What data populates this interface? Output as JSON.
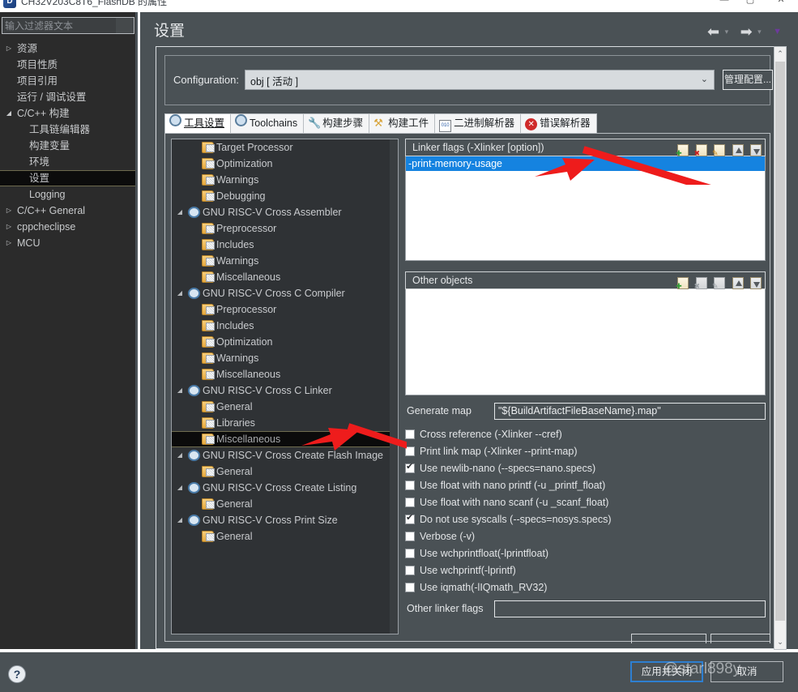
{
  "window": {
    "title": "CH32V203C8T6_FlashDB 的属性",
    "icon": "app-icon",
    "minimize": "—",
    "maximize": "▢",
    "close": "✕"
  },
  "sidebar": {
    "filter_placeholder": "输入过滤器文本",
    "filter_value": "",
    "items": [
      {
        "label": "资源",
        "level": 0,
        "arrow": "▷",
        "selected": false
      },
      {
        "label": "项目性质",
        "level": 0,
        "arrow": "",
        "selected": false
      },
      {
        "label": "项目引用",
        "level": 0,
        "arrow": "",
        "selected": false
      },
      {
        "label": "运行 / 调试设置",
        "level": 0,
        "arrow": "",
        "selected": false
      },
      {
        "label": "C/C++ 构建",
        "level": 0,
        "arrow": "◢",
        "selected": false
      },
      {
        "label": "工具链编辑器",
        "level": 1,
        "arrow": "",
        "selected": false
      },
      {
        "label": "构建变量",
        "level": 1,
        "arrow": "",
        "selected": false
      },
      {
        "label": "环境",
        "level": 1,
        "arrow": "",
        "selected": false
      },
      {
        "label": "设置",
        "level": 1,
        "arrow": "",
        "selected": true
      },
      {
        "label": "Logging",
        "level": 1,
        "arrow": "",
        "selected": false
      },
      {
        "label": "C/C++ General",
        "level": 0,
        "arrow": "▷",
        "selected": false
      },
      {
        "label": "cppcheclipse",
        "level": 0,
        "arrow": "▷",
        "selected": false
      },
      {
        "label": "MCU",
        "level": 0,
        "arrow": "▷",
        "selected": false
      }
    ]
  },
  "page": {
    "title": "设置",
    "nav_back": "⬅",
    "nav_back_chevron": "▾",
    "nav_forward": "➡",
    "nav_forward_chevron": "▾",
    "nav_menu_chevron": "▼"
  },
  "configuration": {
    "label": "Configuration:",
    "value": "obj  [ 活动 ]",
    "chevron": "⌄",
    "manage_button": "管理配置..."
  },
  "tabs": [
    {
      "label": "工具设置",
      "icon": "gear-icon",
      "active": true
    },
    {
      "label": "Toolchains",
      "icon": "gear-icon",
      "active": false
    },
    {
      "label": "构建步骤",
      "icon": "wrench-icon",
      "active": false
    },
    {
      "label": "构建工件",
      "icon": "hammer-icon",
      "active": false
    },
    {
      "label": "二进制解析器",
      "icon": "binary-icon",
      "active": false
    },
    {
      "label": "错误解析器",
      "icon": "error-icon",
      "active": false
    }
  ],
  "tool_tree": [
    {
      "label": "Target Processor",
      "depth": 2,
      "icon": "folder-icon",
      "arrow": "",
      "selected": false
    },
    {
      "label": "Optimization",
      "depth": 2,
      "icon": "folder-icon",
      "arrow": "",
      "selected": false
    },
    {
      "label": "Warnings",
      "depth": 2,
      "icon": "folder-icon",
      "arrow": "",
      "selected": false
    },
    {
      "label": "Debugging",
      "depth": 2,
      "icon": "folder-icon",
      "arrow": "",
      "selected": false
    },
    {
      "label": "GNU RISC-V Cross Assembler",
      "depth": 1,
      "icon": "tool-icon",
      "arrow": "◢",
      "selected": false
    },
    {
      "label": "Preprocessor",
      "depth": 2,
      "icon": "folder-icon",
      "arrow": "",
      "selected": false
    },
    {
      "label": "Includes",
      "depth": 2,
      "icon": "folder-icon",
      "arrow": "",
      "selected": false
    },
    {
      "label": "Warnings",
      "depth": 2,
      "icon": "folder-icon",
      "arrow": "",
      "selected": false
    },
    {
      "label": "Miscellaneous",
      "depth": 2,
      "icon": "folder-icon",
      "arrow": "",
      "selected": false
    },
    {
      "label": "GNU RISC-V Cross C Compiler",
      "depth": 1,
      "icon": "tool-icon",
      "arrow": "◢",
      "selected": false
    },
    {
      "label": "Preprocessor",
      "depth": 2,
      "icon": "folder-icon",
      "arrow": "",
      "selected": false
    },
    {
      "label": "Includes",
      "depth": 2,
      "icon": "folder-icon",
      "arrow": "",
      "selected": false
    },
    {
      "label": "Optimization",
      "depth": 2,
      "icon": "folder-icon",
      "arrow": "",
      "selected": false
    },
    {
      "label": "Warnings",
      "depth": 2,
      "icon": "folder-icon",
      "arrow": "",
      "selected": false
    },
    {
      "label": "Miscellaneous",
      "depth": 2,
      "icon": "folder-icon",
      "arrow": "",
      "selected": false
    },
    {
      "label": "GNU RISC-V Cross C Linker",
      "depth": 1,
      "icon": "tool-icon",
      "arrow": "◢",
      "selected": false
    },
    {
      "label": "General",
      "depth": 2,
      "icon": "folder-icon",
      "arrow": "",
      "selected": false
    },
    {
      "label": "Libraries",
      "depth": 2,
      "icon": "folder-icon",
      "arrow": "",
      "selected": false
    },
    {
      "label": "Miscellaneous",
      "depth": 2,
      "icon": "folder-icon",
      "arrow": "",
      "selected": true
    },
    {
      "label": "GNU RISC-V Cross Create Flash Image",
      "depth": 1,
      "icon": "tool-icon",
      "arrow": "◢",
      "selected": false
    },
    {
      "label": "General",
      "depth": 2,
      "icon": "folder-icon",
      "arrow": "",
      "selected": false
    },
    {
      "label": "GNU RISC-V Cross Create Listing",
      "depth": 1,
      "icon": "tool-icon",
      "arrow": "◢",
      "selected": false
    },
    {
      "label": "General",
      "depth": 2,
      "icon": "folder-icon",
      "arrow": "",
      "selected": false
    },
    {
      "label": "GNU RISC-V Cross Print Size",
      "depth": 1,
      "icon": "tool-icon",
      "arrow": "◢",
      "selected": false
    },
    {
      "label": "General",
      "depth": 2,
      "icon": "folder-icon",
      "arrow": "",
      "selected": false
    }
  ],
  "linker_flags": {
    "title": "Linker flags (-Xlinker [option])",
    "tools": [
      "add-icon",
      "delete-icon",
      "edit-icon",
      "move-up-icon",
      "move-down-icon"
    ],
    "items": [
      "-print-memory-usage"
    ],
    "selected_index": 0
  },
  "other_objects": {
    "title": "Other objects",
    "tools": [
      "add-icon",
      "delete-icon",
      "edit-icon",
      "move-up-icon",
      "move-down-icon"
    ],
    "items": []
  },
  "generate_map": {
    "label": "Generate map",
    "value": "\"${BuildArtifactFileBaseName}.map\""
  },
  "checkboxes": [
    {
      "label": "Cross reference (-Xlinker --cref)",
      "checked": false
    },
    {
      "label": "Print link map (-Xlinker --print-map)",
      "checked": false
    },
    {
      "label": "Use newlib-nano (--specs=nano.specs)",
      "checked": true
    },
    {
      "label": "Use float with nano printf (-u _printf_float)",
      "checked": false
    },
    {
      "label": "Use float with nano scanf (-u _scanf_float)",
      "checked": false
    },
    {
      "label": "Do not use syscalls (--specs=nosys.specs)",
      "checked": true
    },
    {
      "label": "Verbose (-v)",
      "checked": false
    },
    {
      "label": "Use wchprintfloat(-lprintfloat)",
      "checked": false
    },
    {
      "label": "Use wchprintf(-lprintf)",
      "checked": false
    },
    {
      "label": "Use iqmath(-lIQmath_RV32)",
      "checked": false
    }
  ],
  "other_linker_flags": {
    "label": "Other linker flags",
    "value": ""
  },
  "scrollbar": {
    "up": "⌃",
    "down": "⌄"
  },
  "footer": {
    "help": "?",
    "apply_close": "应用并关闭",
    "cancel": "取消",
    "watermark": "@starl898y"
  },
  "colors": {
    "accent_blue": "#1583e0",
    "panel_bg": "#4a5155",
    "tree_bg": "#2f3235",
    "sidebar_bg": "#2b2b2b",
    "annotation_red": "#ee1c1c",
    "button_focus": "#2e7fd1"
  }
}
